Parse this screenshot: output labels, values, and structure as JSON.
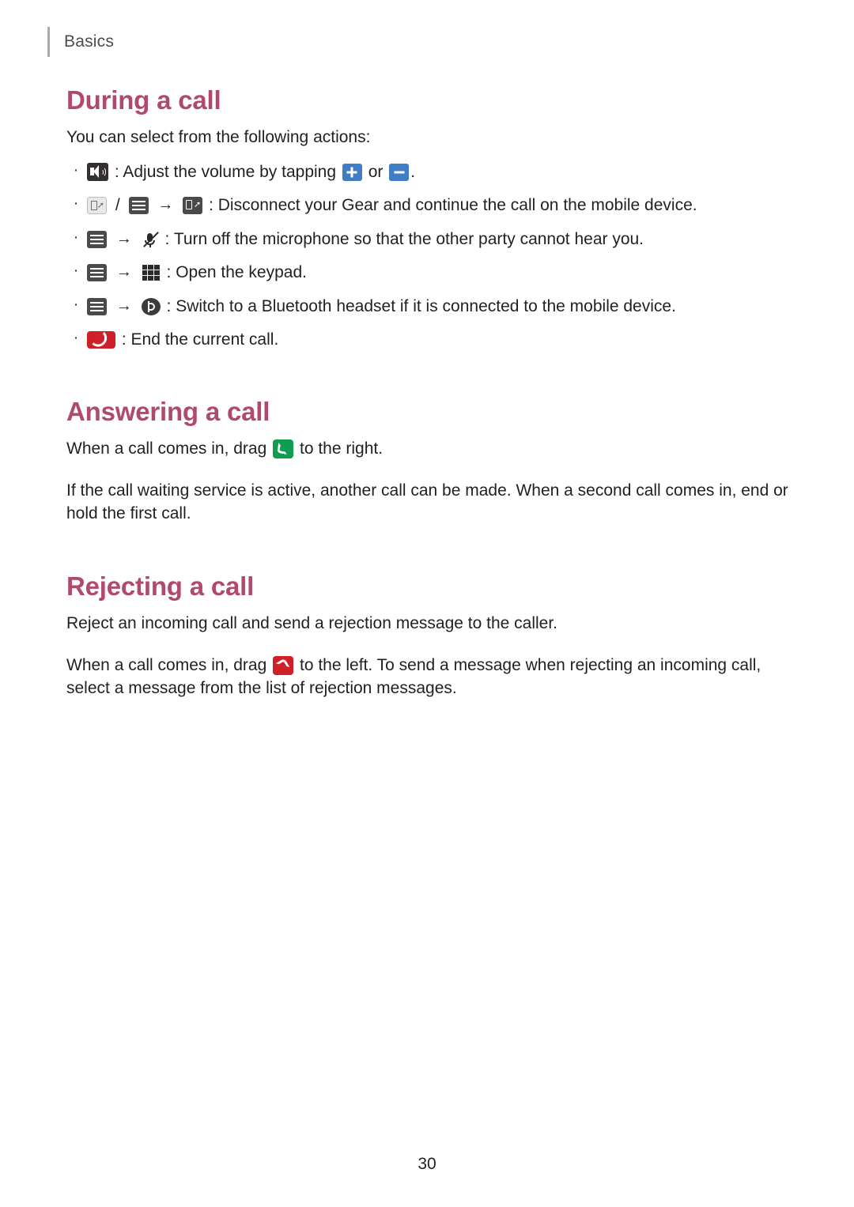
{
  "header": {
    "breadcrumb": "Basics"
  },
  "sections": [
    {
      "title": "During a call",
      "intro": "You can select from the following actions:",
      "bullets": [
        {
          "id": "volume",
          "icons": [
            "speaker-icon"
          ],
          "text_parts": [
            ": Adjust the volume by tapping ",
            " or ",
            "."
          ],
          "inline_icons": [
            "plus-icon",
            "minus-icon"
          ]
        },
        {
          "id": "disconnect-gear",
          "icons": [
            "phone-transfer-light-icon",
            "menu-icon",
            "phone-transfer-dark-icon"
          ],
          "text": ": Disconnect your Gear and continue the call on the mobile device."
        },
        {
          "id": "mute-microphone",
          "icons": [
            "menu-icon",
            "mute-microphone-icon"
          ],
          "text": ": Turn off the microphone so that the other party cannot hear you."
        },
        {
          "id": "open-keypad",
          "icons": [
            "menu-icon",
            "keypad-icon"
          ],
          "text": ": Open the keypad."
        },
        {
          "id": "bluetooth-headset",
          "icons": [
            "menu-icon",
            "bluetooth-headset-icon"
          ],
          "text": ": Switch to a Bluetooth headset if it is connected to the mobile device."
        },
        {
          "id": "end-call",
          "icons": [
            "end-call-icon"
          ],
          "text": ": End the current call."
        }
      ]
    },
    {
      "title": "Answering a call",
      "paragraphs": [
        {
          "before": "When a call comes in, drag ",
          "icon": "answer-call-icon",
          "after": " to the right."
        },
        {
          "text": "If the call waiting service is active, another call can be made. When a second call comes in, end or hold the first call."
        }
      ]
    },
    {
      "title": "Rejecting a call",
      "paragraphs": [
        {
          "text": "Reject an incoming call and send a rejection message to the caller."
        },
        {
          "before": "When a call comes in, drag ",
          "icon": "reject-call-icon",
          "after": " to the left. To send a message when rejecting an incoming call, select a message from the list of rejection messages."
        }
      ]
    }
  ],
  "labels": {
    "arrow": "→",
    "slash": "/",
    "bullet": "·",
    "volume_part1": ": Adjust the volume by tapping",
    "volume_part2": "or",
    "volume_part3": ".",
    "disconnect_text": ": Disconnect your Gear and continue the call on the mobile device.",
    "mute_text": ": Turn off the microphone so that the other party cannot hear you.",
    "keypad_text": ": Open the keypad.",
    "bluetooth_text": ": Switch to a Bluetooth headset if it is connected to the mobile device.",
    "endcall_text": ": End the current call.",
    "answer_before": "When a call comes in, drag",
    "answer_after": "to the right.",
    "answer_para2": "If the call waiting service is active, another call can be made. When a second call comes in, end or hold the first call.",
    "reject_para1": "Reject an incoming call and send a rejection message to the caller.",
    "reject_before": "When a call comes in, drag",
    "reject_after": "to the left. To send a message when rejecting an incoming call, select a message from the list of rejection messages."
  },
  "footer": {
    "page_number": "30"
  },
  "colors": {
    "heading": "#b14a6a",
    "text": "#231f20",
    "header_text": "#4c4c4e",
    "blue_button": "#3f7ec4",
    "red_button": "#cf2027",
    "green_button": "#0f9d4f"
  }
}
